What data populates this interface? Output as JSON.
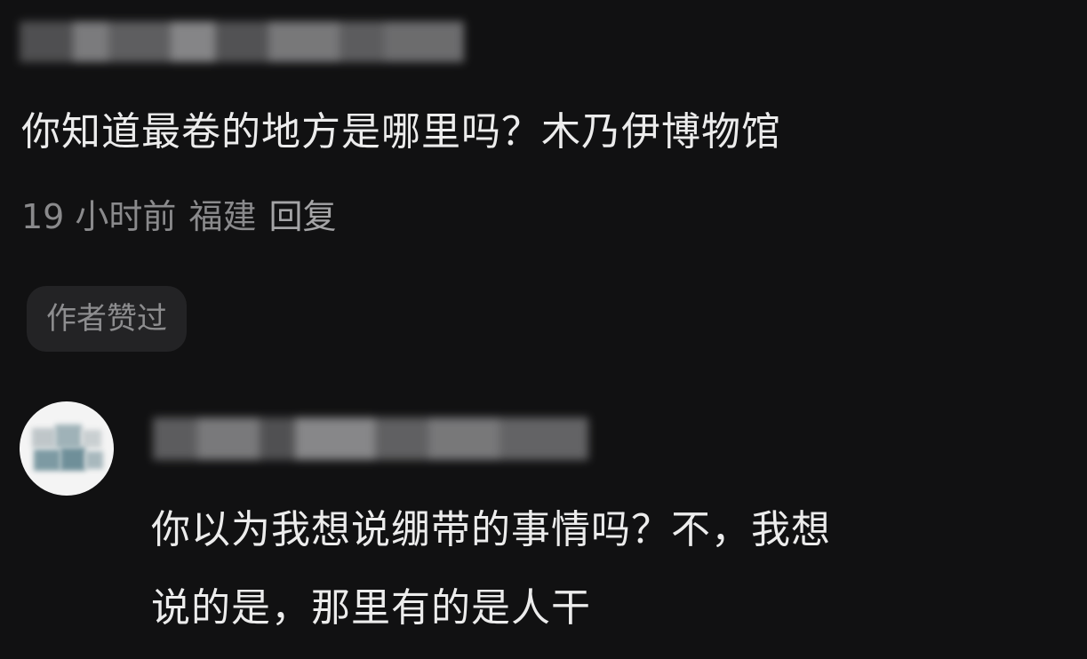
{
  "comment": {
    "text": "你知道最卷的地方是哪里吗？木乃伊博物馆",
    "time": "19 小时前",
    "location": "福建",
    "reply_label": "回复",
    "liked_badge": "作者赞过"
  },
  "reply": {
    "line1": "你以为我想说绷带的事情吗？不，我想",
    "line2": "说的是，那里有的是人干"
  }
}
